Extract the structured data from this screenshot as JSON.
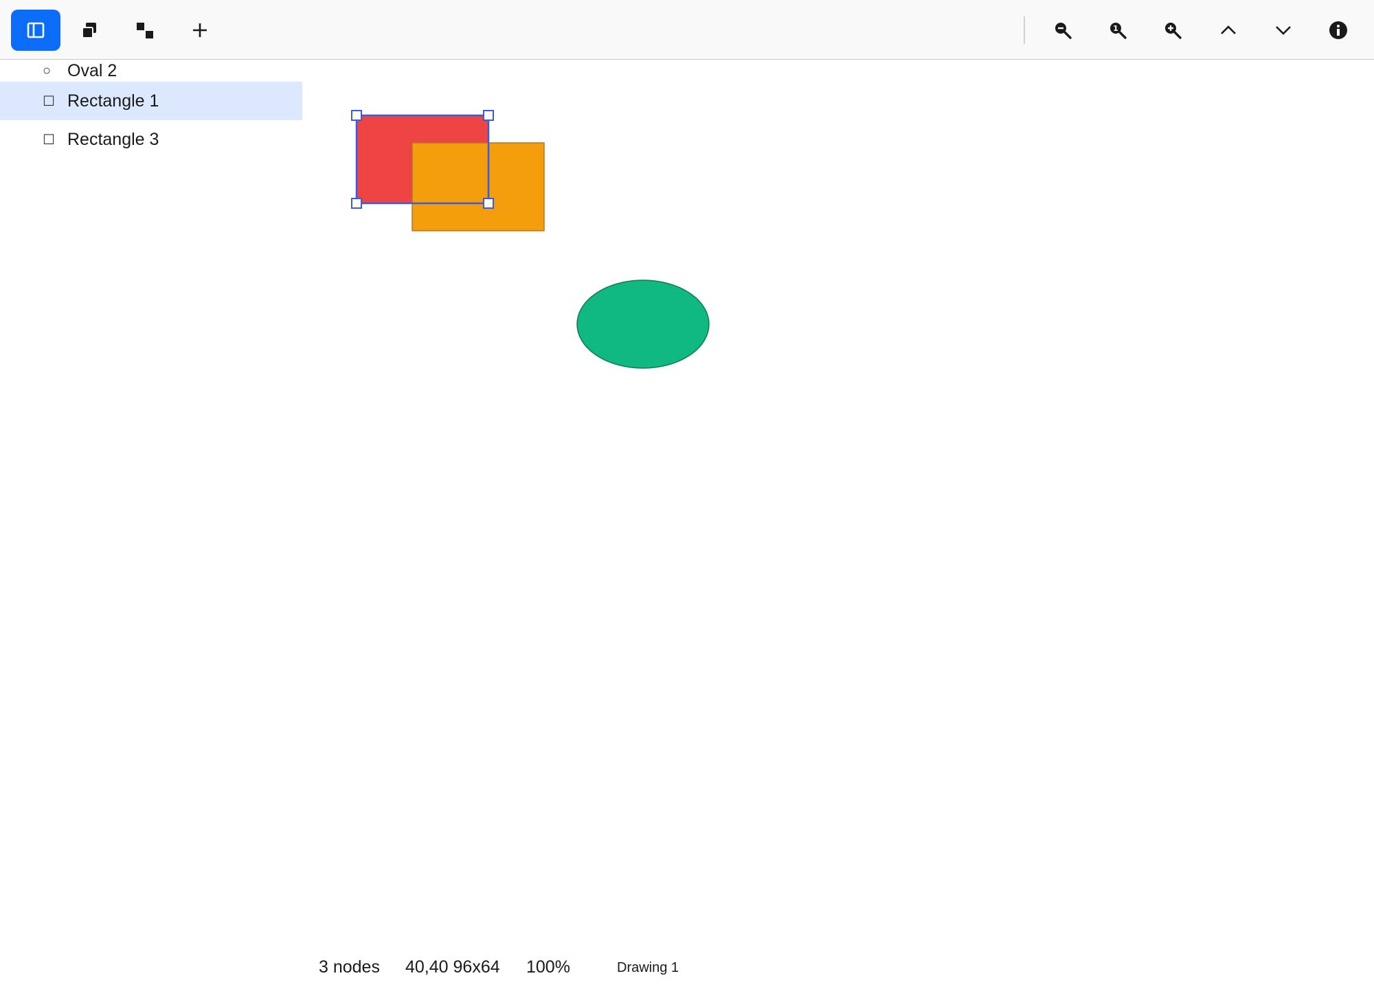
{
  "toolbar": {
    "left_buttons": [
      {
        "name": "toggle-layers-button",
        "icon": "sidebar-panel-icon",
        "active": true
      },
      {
        "name": "bring-to-front-button",
        "icon": "bring-to-front-icon",
        "active": false
      },
      {
        "name": "send-to-back-button",
        "icon": "send-to-back-icon",
        "active": false
      },
      {
        "name": "add-shape-button",
        "icon": "plus-icon",
        "active": false
      }
    ],
    "right_buttons": [
      {
        "name": "zoom-out-button",
        "icon": "zoom-out-icon"
      },
      {
        "name": "zoom-reset-button",
        "icon": "zoom-reset-icon"
      },
      {
        "name": "zoom-in-button",
        "icon": "zoom-in-icon"
      },
      {
        "name": "previous-button",
        "icon": "chevron-up-icon"
      },
      {
        "name": "next-button",
        "icon": "chevron-down-icon"
      },
      {
        "name": "info-button",
        "icon": "info-icon"
      }
    ]
  },
  "layers": {
    "items": [
      {
        "glyph": "○",
        "label": "Oval 2",
        "selected": false
      },
      {
        "glyph": "☐",
        "label": "Rectangle 1",
        "selected": true
      },
      {
        "glyph": "☐",
        "label": "Rectangle 3",
        "selected": false
      }
    ]
  },
  "canvas": {
    "shapes": [
      {
        "name": "rectangle-1",
        "kind": "rect",
        "fill": "#ef4444",
        "stroke": "#3b5bdb",
        "selected": true
      },
      {
        "name": "rectangle-3",
        "kind": "rect",
        "fill": "#f59e0b",
        "stroke": "#b07a28",
        "selected": false
      },
      {
        "name": "oval-2",
        "kind": "ellipse",
        "fill": "#10b981",
        "stroke": "#0e7a58",
        "selected": false
      }
    ],
    "selection_color": "#3b5bdb"
  },
  "status": {
    "node_count": "3 nodes",
    "selection_geometry": "40,40 96x64",
    "zoom": "100%",
    "document_name": "Drawing 1"
  },
  "colors": {
    "accent": "#0b6cf7",
    "selected_row": "#dce8fd"
  }
}
